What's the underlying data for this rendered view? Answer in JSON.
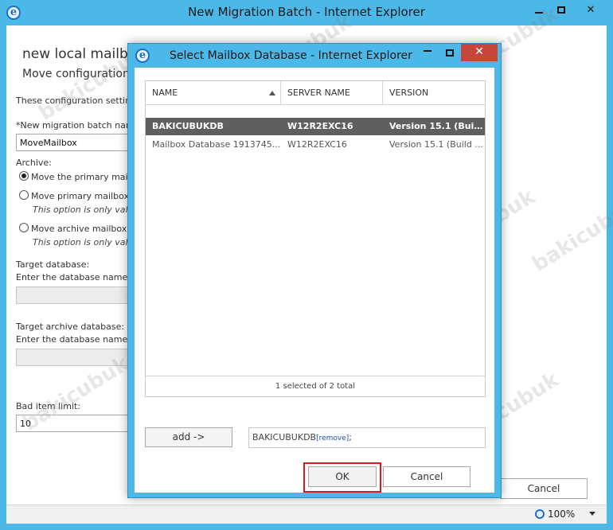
{
  "outer_window": {
    "title": "New Migration Batch - Internet Explorer",
    "controls": {
      "minimize": "minimize",
      "maximize": "maximize",
      "close": "✕"
    }
  },
  "background_form": {
    "heading1": "new local mailbox",
    "heading2": "Move configuration",
    "intro_text": "These configuration setting",
    "batch_name_label": "*New migration batch nam",
    "batch_name_value": "MoveMailbox",
    "archive_label": "Archive:",
    "archive_options": [
      {
        "label": "Move the primary mailb",
        "note": "",
        "checked": true
      },
      {
        "label": "Move primary mailbox",
        "note": "This option is only valid",
        "checked": false
      },
      {
        "label": "Move archive mailbox c",
        "note": "This option is only valid",
        "checked": false
      }
    ],
    "target_db_label": "Target database:",
    "target_db_hint": "Enter the database name y",
    "target_archive_label": "Target archive database:",
    "target_archive_hint": "Enter the database name y",
    "bad_item_label": "Bad item limit:",
    "bad_item_value": "10",
    "cancel_label": "Cancel"
  },
  "status_bar": {
    "zoom": "100%"
  },
  "dialog": {
    "title": "Select Mailbox Database - Internet Explorer",
    "close_glyph": "✕",
    "columns": [
      "NAME",
      "SERVER NAME",
      "VERSION"
    ],
    "rows": [
      {
        "name": "BAKICUBUKDB",
        "server": "W12R2EXC16",
        "version": "Version 15.1 (Build...",
        "selected": true
      },
      {
        "name": "Mailbox Database 1913745...",
        "server": "W12R2EXC16",
        "version": "Version 15.1 (Build ...",
        "selected": false
      }
    ],
    "footer": "1 selected of 2 total",
    "add_label": "add ->",
    "selected_value": "BAKICUBUKDB",
    "remove_label": "[remove]",
    "selected_suffix": ";",
    "ok_label": "OK",
    "cancel_label": "Cancel"
  },
  "watermark_text": "bakicubuk",
  "colors": {
    "titlebar": "#4cb8e8",
    "selected_row": "#5f5f5f",
    "highlight": "#d11f1f",
    "close_button": "#c7463b"
  }
}
